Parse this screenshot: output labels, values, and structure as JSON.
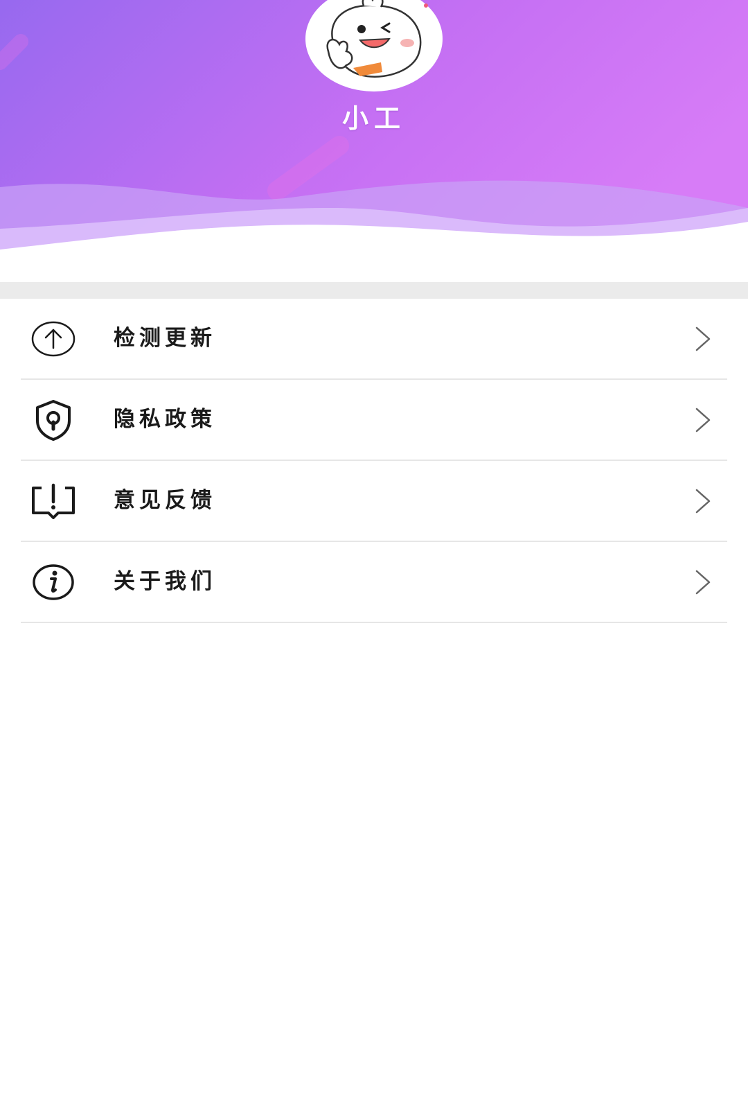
{
  "profile": {
    "username": "小工"
  },
  "menu": {
    "items": [
      {
        "label": "检测更新",
        "icon": "upload-arrow-icon"
      },
      {
        "label": "隐私政策",
        "icon": "shield-lock-icon"
      },
      {
        "label": "意见反馈",
        "icon": "feedback-alert-icon"
      },
      {
        "label": "关于我们",
        "icon": "info-icon"
      }
    ]
  },
  "colors": {
    "header_gradient_start": "#9b6cf0",
    "header_gradient_end": "#d57af7",
    "divider": "#ebebeb",
    "text": "#1a1a1a"
  }
}
